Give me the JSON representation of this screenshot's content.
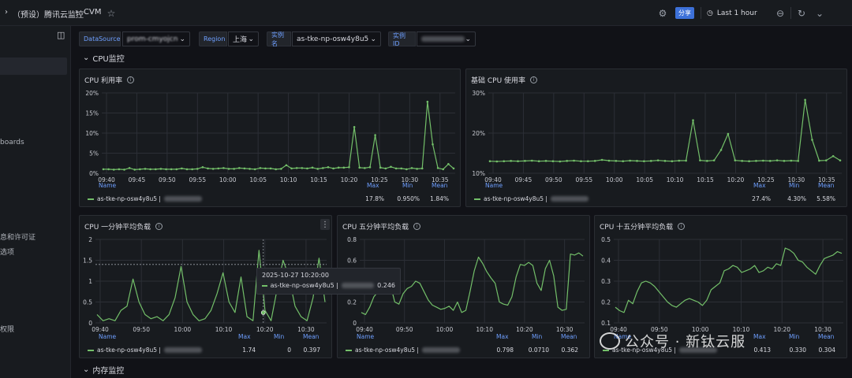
{
  "header": {
    "breadcrumb_sep": "›",
    "folder": "（预设）腾讯云监控",
    "breadcrumb_sep2": "›",
    "dashboard": "CVM",
    "share_label": "分享",
    "time_range": "Last 1 hour"
  },
  "sidebar": {
    "items": [
      {
        "label": "boards"
      },
      {
        "label": "息和许可证"
      },
      {
        "label": "选项"
      },
      {
        "label": "权限"
      }
    ]
  },
  "variables": [
    {
      "label": "DataSource",
      "value": "prom-cmyojcn"
    },
    {
      "label": "Region",
      "value": "上海"
    },
    {
      "label": "实例名",
      "value": "as-tke-np-osw4y8u5"
    },
    {
      "label": "实例ID",
      "value": ""
    }
  ],
  "rows": {
    "cpu": "CPU监控",
    "memory": "内存监控"
  },
  "legend_heads": {
    "name": "Name",
    "max": "Max",
    "min": "Min",
    "mean": "Mean"
  },
  "series_name": "as-tke-np-osw4y8u5 |",
  "tooltip": {
    "time": "2025-10-27 10:20:00",
    "series": "as-tke-np-osw4y8u5 |",
    "value": "0.246"
  },
  "watermark": "公众号 · 新钛云服",
  "colors": {
    "series": "#73bf69",
    "accent": "#6e9fff",
    "share": "#3d71d9"
  },
  "panels": [
    {
      "title": "CPU 利用率",
      "max": "17.8%",
      "min": "0.950%",
      "mean": "1.84%"
    },
    {
      "title": "基础 CPU 使用率",
      "max": "27.4%",
      "min": "4.30%",
      "mean": "5.58%"
    },
    {
      "title": "CPU 一分钟平均负载",
      "max": "1.74",
      "min": "0",
      "mean": "0.397"
    },
    {
      "title": "CPU 五分钟平均负载",
      "max": "0.798",
      "min": "0.0710",
      "mean": "0.362"
    },
    {
      "title": "CPU 十五分钟平均负载",
      "max": "0.413",
      "min": "0.330",
      "mean": "0.304"
    }
  ],
  "chart_data": [
    {
      "type": "line",
      "title": "CPU 利用率",
      "x": [
        "09:40",
        "09:45",
        "09:50",
        "09:55",
        "10:00",
        "10:05",
        "10:10",
        "10:15",
        "10:20",
        "10:25",
        "10:30",
        "10:35"
      ],
      "yticks": [
        "0%",
        "5%",
        "10%",
        "15%",
        "20%"
      ],
      "ylim": [
        0,
        20
      ],
      "series": [
        {
          "name": "as-tke-np-osw4y8u5",
          "values": [
            1,
            1,
            0.9,
            1,
            0.9,
            1.3,
            0.9,
            1,
            1.1,
            1,
            1,
            1.1,
            1,
            1,
            1,
            1.2,
            1,
            1,
            1.1,
            1.5,
            1.2,
            1.1,
            1.2,
            1.3,
            1.1,
            1.1,
            1.3,
            1.2,
            1.1,
            1,
            1.3,
            1.2,
            1.2,
            1,
            1.1,
            2,
            1.2,
            1.3,
            1.3,
            1.2,
            1.4,
            1.1,
            1.3,
            1.5,
            1.2,
            1.4,
            1.4,
            1.5,
            11.5,
            1.4,
            1.3,
            1.5,
            9.5,
            1.4,
            1.2,
            1.6,
            1.2,
            1.2,
            1,
            1.3,
            1.1,
            1.2,
            17.8,
            7.2,
            1.3,
            1,
            2.3,
            1.2
          ]
        }
      ]
    },
    {
      "type": "line",
      "title": "基础 CPU 使用率",
      "x": [
        "09:40",
        "09:45",
        "09:50",
        "09:55",
        "10:00",
        "10:05",
        "10:10",
        "10:15",
        "10:20",
        "10:25",
        "10:30",
        "10:35"
      ],
      "yticks": [
        "10%",
        "20%",
        "30%"
      ],
      "ylim": [
        0,
        30
      ],
      "series": [
        {
          "name": "as-tke-np-osw4y8u5",
          "values": [
            4.5,
            4.4,
            4.5,
            4.6,
            4.5,
            4.6,
            4.7,
            4.5,
            4.6,
            4.5,
            4.4,
            4.6,
            4.7,
            4.5,
            4.5,
            4.6,
            5,
            4.7,
            4.6,
            4.5,
            4.7,
            4.6,
            4.5,
            4.6,
            4.8,
            4.6,
            4.5,
            4.7,
            4.7,
            19.8,
            4.8,
            4.6,
            4.8,
            8.7,
            14.7,
            4.8,
            4.6,
            4.5,
            4.6,
            4.7,
            4.6,
            4.8,
            4.6,
            4.7,
            4.6,
            27.4,
            12.5,
            4.7,
            4.8,
            6.4,
            4.8
          ]
        }
      ]
    },
    {
      "type": "line",
      "title": "CPU 一分钟平均负载",
      "x": [
        "09:40",
        "09:50",
        "10:00",
        "10:10",
        "10:20",
        "10:30"
      ],
      "yticks": [
        "0",
        "0.5",
        "1",
        "1.5",
        "2"
      ],
      "ylim": [
        0,
        2
      ],
      "series": [
        {
          "name": "as-tke-np-osw4y8u5",
          "values": [
            0.2,
            0.05,
            0.1,
            0.05,
            0.3,
            0.4,
            1.05,
            0.5,
            0.2,
            0.1,
            0.15,
            0.05,
            0.2,
            0.6,
            1.35,
            0.5,
            0.2,
            0.05,
            0.1,
            0.3,
            0.7,
            1.2,
            0.5,
            0.25,
            1.1,
            0.15,
            0.05,
            1.74,
            0.3,
            0.05,
            0.8,
            1.5,
            1.1,
            0.4,
            0.15,
            0.05,
            0.6,
            1.55,
            0.5
          ]
        }
      ]
    },
    {
      "type": "line",
      "title": "CPU 五分钟平均负载",
      "x": [
        "09:40",
        "09:50",
        "10:00",
        "10:10",
        "10:20",
        "10:30"
      ],
      "yticks": [
        "0",
        "0.2",
        "0.4",
        "0.6",
        "0.8"
      ],
      "ylim": [
        0,
        0.8
      ],
      "series": [
        {
          "name": "as-tke-np-osw4y8u5",
          "values": [
            0.1,
            0.08,
            0.15,
            0.25,
            0.3,
            0.35,
            0.4,
            0.36,
            0.2,
            0.18,
            0.28,
            0.33,
            0.35,
            0.4,
            0.38,
            0.3,
            0.22,
            0.17,
            0.15,
            0.13,
            0.14,
            0.16,
            0.12,
            0.2,
            0.1,
            0.12,
            0.3,
            0.5,
            0.63,
            0.57,
            0.49,
            0.43,
            0.38,
            0.2,
            0.18,
            0.17,
            0.25,
            0.44,
            0.56,
            0.55,
            0.58,
            0.55,
            0.38,
            0.31,
            0.52,
            0.6,
            0.45,
            0.15,
            0.12,
            0.13,
            0.66,
            0.65,
            0.67,
            0.64
          ]
        }
      ]
    },
    {
      "type": "line",
      "title": "CPU 十五分钟平均负载",
      "x": [
        "09:40",
        "09:50",
        "10:00",
        "10:10",
        "10:20",
        "10:30"
      ],
      "yticks": [
        "0.1",
        "0.2",
        "0.3",
        "0.4",
        "0.5"
      ],
      "ylim": [
        0.07,
        0.55
      ],
      "series": [
        {
          "name": "as-tke-np-osw4y8u5",
          "values": [
            0.16,
            0.14,
            0.13,
            0.2,
            0.18,
            0.25,
            0.3,
            0.31,
            0.3,
            0.28,
            0.25,
            0.22,
            0.19,
            0.17,
            0.16,
            0.18,
            0.2,
            0.21,
            0.2,
            0.19,
            0.17,
            0.2,
            0.26,
            0.28,
            0.3,
            0.37,
            0.38,
            0.4,
            0.39,
            0.36,
            0.37,
            0.38,
            0.4,
            0.36,
            0.37,
            0.39,
            0.38,
            0.41,
            0.4,
            0.5,
            0.49,
            0.47,
            0.43,
            0.42,
            0.39,
            0.37,
            0.35,
            0.4,
            0.44,
            0.45,
            0.46,
            0.48,
            0.47
          ]
        }
      ]
    }
  ]
}
